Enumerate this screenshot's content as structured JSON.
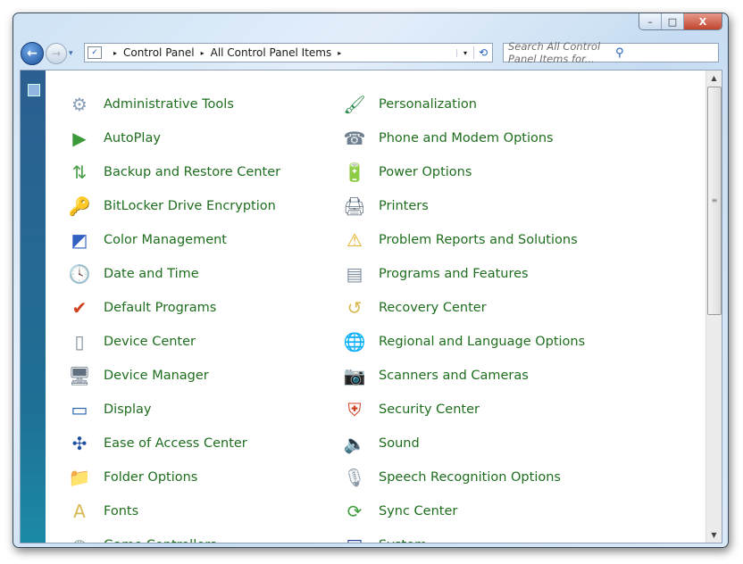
{
  "window": {
    "minimize": "–",
    "maximize": "□",
    "close": "X"
  },
  "nav": {
    "back": "←",
    "forward": "→",
    "history": "▾"
  },
  "breadcrumb": [
    "Control Panel",
    "All Control Panel Items"
  ],
  "address": {
    "sep": "▸",
    "dropdown": "▾",
    "refresh": "⟲"
  },
  "search": {
    "placeholder": "Search All Control Panel Items for...",
    "icon": "⚲"
  },
  "scrollbar": {
    "up": "▲",
    "down": "▼",
    "grip": "≡"
  },
  "items_left": [
    {
      "label": "Administrative Tools",
      "icon": "⚙",
      "color": "#8aa0b8"
    },
    {
      "label": "AutoPlay",
      "icon": "▶",
      "color": "#3a9a3a"
    },
    {
      "label": "Backup and Restore Center",
      "icon": "⇅",
      "color": "#4aa04a"
    },
    {
      "label": "BitLocker Drive Encryption",
      "icon": "🔑",
      "color": "#c0a040"
    },
    {
      "label": "Color Management",
      "icon": "◩",
      "color": "#3060c0"
    },
    {
      "label": "Date and Time",
      "icon": "🕓",
      "color": "#5080b0"
    },
    {
      "label": "Default Programs",
      "icon": "✔",
      "color": "#d04020"
    },
    {
      "label": "Device Center",
      "icon": "▯",
      "color": "#8090a0"
    },
    {
      "label": "Device Manager",
      "icon": "🖥",
      "color": "#607080"
    },
    {
      "label": "Display",
      "icon": "▭",
      "color": "#2060b0"
    },
    {
      "label": "Ease of Access Center",
      "icon": "✣",
      "color": "#2050a0"
    },
    {
      "label": "Folder Options",
      "icon": "📁",
      "color": "#d8b850"
    },
    {
      "label": "Fonts",
      "icon": "A",
      "color": "#d8b850"
    },
    {
      "label": "Game Controllers",
      "icon": "◍",
      "color": "#9aa"
    }
  ],
  "items_right": [
    {
      "label": "Personalization",
      "icon": "🖌",
      "color": "#2a8a4a"
    },
    {
      "label": "Phone and Modem Options",
      "icon": "☎",
      "color": "#708090"
    },
    {
      "label": "Power Options",
      "icon": "🔋",
      "color": "#40a040"
    },
    {
      "label": "Printers",
      "icon": "🖨",
      "color": "#607080"
    },
    {
      "label": "Problem Reports and Solutions",
      "icon": "⚠",
      "color": "#e0b020"
    },
    {
      "label": "Programs and Features",
      "icon": "▤",
      "color": "#8090a0"
    },
    {
      "label": "Recovery Center",
      "icon": "↺",
      "color": "#d8b850"
    },
    {
      "label": "Regional and Language Options",
      "icon": "🌐",
      "color": "#3080c0"
    },
    {
      "label": "Scanners and Cameras",
      "icon": "📷",
      "color": "#607080"
    },
    {
      "label": "Security Center",
      "icon": "⛨",
      "color": "#d04020"
    },
    {
      "label": "Sound",
      "icon": "🔈",
      "color": "#8a9aa8"
    },
    {
      "label": "Speech Recognition Options",
      "icon": "🎙",
      "color": "#8a9aa8"
    },
    {
      "label": "Sync Center",
      "icon": "⟳",
      "color": "#40a040"
    },
    {
      "label": "System",
      "icon": "▣",
      "color": "#2040a0"
    }
  ]
}
